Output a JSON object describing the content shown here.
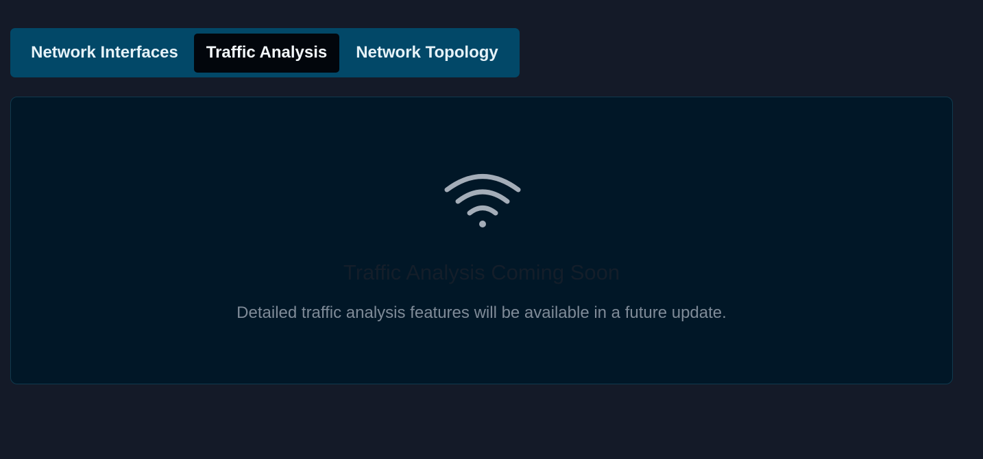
{
  "tabs": [
    {
      "label": "Network Interfaces",
      "active": false
    },
    {
      "label": "Traffic Analysis",
      "active": true
    },
    {
      "label": "Network Topology",
      "active": false
    }
  ],
  "panel": {
    "icon": "wifi-icon",
    "title": "Traffic Analysis Coming Soon",
    "subtitle": "Detailed traffic analysis features will be available in a future update."
  },
  "colors": {
    "background": "#141a28",
    "tabbar": "#024868",
    "active_tab": "#02060c",
    "panel": "#011727",
    "icon": "#a4adb8"
  }
}
